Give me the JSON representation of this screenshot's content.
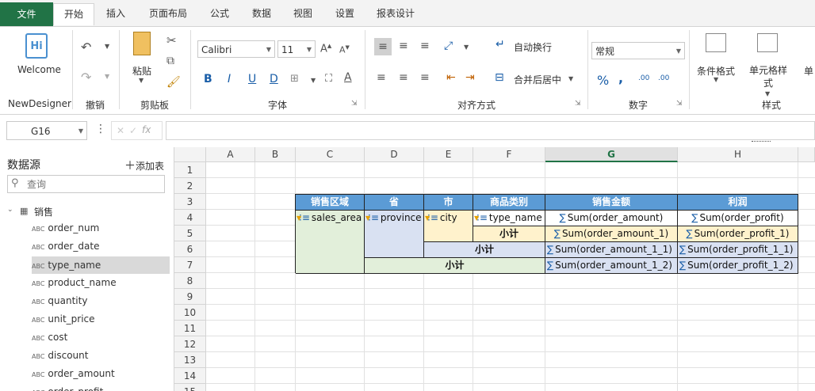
{
  "tabs": [
    "文件",
    "开始",
    "插入",
    "页面布局",
    "公式",
    "数据",
    "视图",
    "设置",
    "报表设计"
  ],
  "ribbon": {
    "welcome": {
      "label": "Welcome",
      "group": "NewDesigner"
    },
    "undo_group": "撤销",
    "clipboard": {
      "paste": "粘贴",
      "group": "剪贴板"
    },
    "font": {
      "name": "Calibri",
      "size": "11",
      "group": "字体",
      "bold": "B",
      "italic": "I",
      "underline": "U",
      "dunderline": "D"
    },
    "align": {
      "wrap": "自动换行",
      "merge": "合并后居中",
      "group": "对齐方式"
    },
    "number": {
      "format": "常规",
      "group": "数字",
      "percent": "%",
      "comma": ","
    },
    "styles": {
      "cond": "条件格式",
      "cellstyle": "单元格样式",
      "group": "样式",
      "more": "单"
    }
  },
  "formula_bar": {
    "name_box": "G16",
    "fx": "fx",
    "value": ""
  },
  "data_source": {
    "title": "数据源",
    "add": "添加表",
    "search_placeholder": "查询",
    "table": "销售",
    "fields": [
      "order_num",
      "order_date",
      "type_name",
      "product_name",
      "quantity",
      "unit_price",
      "cost",
      "discount",
      "order_amount",
      "order_profit"
    ],
    "selected": "type_name",
    "abc": "ABC"
  },
  "sheet": {
    "columns": [
      "A",
      "B",
      "C",
      "D",
      "E",
      "F",
      "G",
      "H"
    ],
    "selected_col": "G",
    "rows": [
      "1",
      "2",
      "3",
      "4",
      "5",
      "6",
      "7",
      "8",
      "9",
      "10",
      "11",
      "12",
      "13",
      "14",
      "15"
    ],
    "headers": [
      "销售区域",
      "省",
      "市",
      "商品类别",
      "销售金额",
      "利润"
    ],
    "c4": "sales_area",
    "d4": "province",
    "e4": "city",
    "f4": "type_name",
    "g4": "Sum(order_amount)",
    "h4": "Sum(order_profit)",
    "f5": "小计",
    "g5": "Sum(order_amount_1)",
    "h5": "Sum(order_profit_1)",
    "e6": "小计",
    "g6": "Sum(order_amount_1_1)",
    "h6": "Sum(order_profit_1_1)",
    "d7": "小计",
    "g7": "Sum(order_amount_1_2)",
    "h7": "Sum(order_profit_1_2)",
    "sigma": "∑",
    "colors": {
      "header": "#5b9bd5",
      "yellow": "#fff2cc",
      "green": "#e2efda",
      "blue": "#d9e1f2",
      "accent": "#217346"
    }
  }
}
